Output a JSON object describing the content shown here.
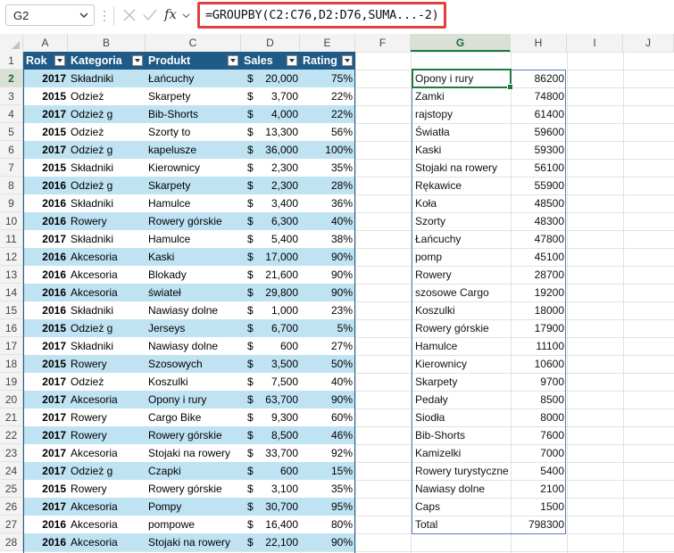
{
  "formula_bar": {
    "name_box": "G2",
    "fx_label": "fx",
    "formula": "=GROUPBY(C2:C76,D2:D76,SUMA...-2)"
  },
  "columns": [
    "A",
    "B",
    "C",
    "D",
    "E",
    "F",
    "G",
    "H",
    "I",
    "J"
  ],
  "rows": [
    "1",
    "2",
    "3",
    "4",
    "5",
    "6",
    "7",
    "8",
    "9",
    "10",
    "11",
    "12",
    "13",
    "14",
    "15",
    "16",
    "17",
    "18",
    "19",
    "20",
    "21",
    "22",
    "23",
    "24",
    "25",
    "26",
    "27",
    "28"
  ],
  "table": {
    "headers": [
      "Rok",
      "Kategoria",
      "Produkt",
      "Sales",
      "Rating"
    ],
    "rows": [
      {
        "rok": "2017",
        "kat": "Składniki",
        "prod": "Łańcuchy",
        "cur": "$",
        "sales": "20,000",
        "rating": "75%"
      },
      {
        "rok": "2015",
        "kat": "Odzież",
        "prod": "Skarpety",
        "cur": "$",
        "sales": "3,700",
        "rating": "22%"
      },
      {
        "rok": "2017",
        "kat": "Odzież      g",
        "prod": "Bib-Shorts",
        "cur": "$",
        "sales": "4,000",
        "rating": "22%"
      },
      {
        "rok": "2015",
        "kat": "Odzież",
        "prod": "Szorty to",
        "cur": "$",
        "sales": "13,300",
        "rating": "56%"
      },
      {
        "rok": "2017",
        "kat": "Odzież      g",
        "prod": "kapelusze",
        "cur": "$",
        "sales": "36,000",
        "rating": "100%"
      },
      {
        "rok": "2015",
        "kat": "Składniki",
        "prod": "Kierownicy",
        "cur": "$",
        "sales": "2,300",
        "rating": "35%"
      },
      {
        "rok": "2016",
        "kat": "Odzież      g",
        "prod": "Skarpety",
        "cur": "$",
        "sales": "2,300",
        "rating": "28%"
      },
      {
        "rok": "2016",
        "kat": "Składniki",
        "prod": "Hamulce",
        "cur": "$",
        "sales": "3,400",
        "rating": "36%"
      },
      {
        "rok": "2016",
        "kat": "Rowery",
        "prod": "Rowery górskie",
        "cur": "$",
        "sales": "6,300",
        "rating": "40%"
      },
      {
        "rok": "2017",
        "kat": "Składniki",
        "prod": "Hamulce",
        "cur": "$",
        "sales": "5,400",
        "rating": "38%"
      },
      {
        "rok": "2016",
        "kat": "Akcesoria",
        "prod": "Kaski",
        "cur": "$",
        "sales": "17,000",
        "rating": "90%"
      },
      {
        "rok": "2016",
        "kat": "Akcesoria",
        "prod": "Blokady",
        "cur": "$",
        "sales": "21,600",
        "rating": "90%"
      },
      {
        "rok": "2016",
        "kat": "Akcesoria",
        "prod": "świateł",
        "cur": "$",
        "sales": "29,800",
        "rating": "90%"
      },
      {
        "rok": "2016",
        "kat": "Składniki",
        "prod": "Nawiasy dolne",
        "cur": "$",
        "sales": "1,000",
        "rating": "23%"
      },
      {
        "rok": "2015",
        "kat": "Odzież      g",
        "prod": "Jerseys",
        "cur": "$",
        "sales": "6,700",
        "rating": "5%"
      },
      {
        "rok": "2017",
        "kat": "Składniki",
        "prod": "Nawiasy dolne",
        "cur": "$",
        "sales": "600",
        "rating": "27%"
      },
      {
        "rok": "2015",
        "kat": "Rowery",
        "prod": "Szosowych",
        "cur": "$",
        "sales": "3,500",
        "rating": "50%"
      },
      {
        "rok": "2017",
        "kat": "Odzież",
        "prod": "Koszulki",
        "cur": "$",
        "sales": "7,500",
        "rating": "40%"
      },
      {
        "rok": "2017",
        "kat": "Akcesoria",
        "prod": "Opony i rury",
        "cur": "$",
        "sales": "63,700",
        "rating": "90%"
      },
      {
        "rok": "2017",
        "kat": "Rowery",
        "prod": "Cargo Bike",
        "cur": "$",
        "sales": "9,300",
        "rating": "60%"
      },
      {
        "rok": "2017",
        "kat": "Rowery",
        "prod": "Rowery górskie",
        "cur": "$",
        "sales": "8,500",
        "rating": "46%"
      },
      {
        "rok": "2017",
        "kat": "Akcesoria",
        "prod": "Stojaki na rowery",
        "cur": "$",
        "sales": "33,700",
        "rating": "92%"
      },
      {
        "rok": "2017",
        "kat": "Odzież      g",
        "prod": "Czapki",
        "cur": "$",
        "sales": "600",
        "rating": "15%"
      },
      {
        "rok": "2015",
        "kat": "Rowery",
        "prod": "Rowery górskie",
        "cur": "$",
        "sales": "3,100",
        "rating": "35%"
      },
      {
        "rok": "2017",
        "kat": "Akcesoria",
        "prod": "Pompy",
        "cur": "$",
        "sales": "30,700",
        "rating": "95%"
      },
      {
        "rok": "2016",
        "kat": "Akcesoria",
        "prod": "pompowe",
        "cur": "$",
        "sales": "16,400",
        "rating": "80%"
      },
      {
        "rok": "2016",
        "kat": "Akcesoria",
        "prod": "Stojaki na rowery",
        "cur": "$",
        "sales": "22,100",
        "rating": "90%"
      }
    ]
  },
  "groupby": [
    {
      "label": "Opony i rury",
      "value": "86200"
    },
    {
      "label": "Zamki",
      "value": "74800"
    },
    {
      "label": "rajstopy",
      "value": "61400"
    },
    {
      "label": "Światła",
      "value": "59600"
    },
    {
      "label": "Kaski",
      "value": "59300"
    },
    {
      "label": "Stojaki na rowery",
      "value": "56100"
    },
    {
      "label": "Rękawice",
      "value": "55900"
    },
    {
      "label": "Koła",
      "value": "48500"
    },
    {
      "label": "Szorty",
      "value": "48300"
    },
    {
      "label": "Łańcuchy",
      "value": "47800"
    },
    {
      "label": "pomp",
      "value": "45100"
    },
    {
      "label": "Rowery",
      "value": "28700"
    },
    {
      "label": "szosowe Cargo",
      "value": "19200"
    },
    {
      "label": "Koszulki",
      "value": "18000"
    },
    {
      "label": "Rowery górskie",
      "value": "17900"
    },
    {
      "label": "Hamulce",
      "value": "11100"
    },
    {
      "label": "Kierownicy",
      "value": "10600"
    },
    {
      "label": "Skarpety",
      "value": "9700"
    },
    {
      "label": "Pedały",
      "value": "8500"
    },
    {
      "label": "Siodła",
      "value": "8000"
    },
    {
      "label": "Bib-Shorts",
      "value": "7600"
    },
    {
      "label": "Kamizelki",
      "value": "7000"
    },
    {
      "label": "Rowery turystyczne",
      "value": "5400"
    },
    {
      "label": "Nawiasy dolne",
      "value": "2100"
    },
    {
      "label": "Caps",
      "value": "1500"
    },
    {
      "label": "Total",
      "value": "798300"
    }
  ],
  "colors": {
    "header_blue": "#1f5b86",
    "band_blue": "#bfe3f2",
    "select_green": "#1d7a3e",
    "formula_border": "#e04040"
  }
}
